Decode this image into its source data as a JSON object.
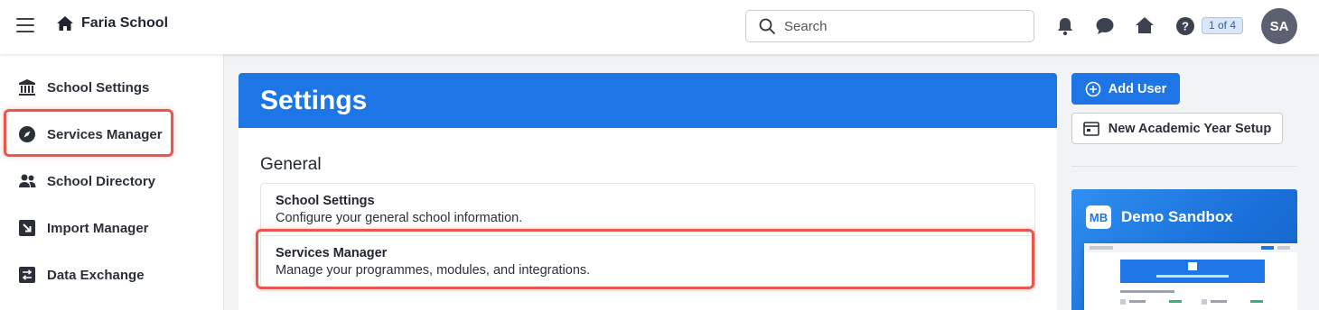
{
  "header": {
    "school_name": "Faria School",
    "search_placeholder": "Search",
    "pager": "1 of 4",
    "avatar_initials": "SA"
  },
  "sidebar": {
    "items": [
      {
        "label": "School Settings",
        "icon": "bank-icon"
      },
      {
        "label": "Services Manager",
        "icon": "compass-icon"
      },
      {
        "label": "School Directory",
        "icon": "people-icon"
      },
      {
        "label": "Import Manager",
        "icon": "import-arrow-icon"
      },
      {
        "label": "Data Exchange",
        "icon": "exchange-icon"
      }
    ]
  },
  "main": {
    "title": "Settings",
    "section_title": "General",
    "items": [
      {
        "title": "School Settings",
        "description": "Configure your general school information."
      },
      {
        "title": "Services Manager",
        "description": "Manage your programmes, modules, and integrations."
      }
    ]
  },
  "actions": {
    "add_user": "Add User",
    "new_year": "New Academic Year Setup"
  },
  "promo": {
    "logo": "MB",
    "title": "Demo Sandbox"
  },
  "colors": {
    "primary": "#1d75e6",
    "highlight": "#e8574a"
  }
}
